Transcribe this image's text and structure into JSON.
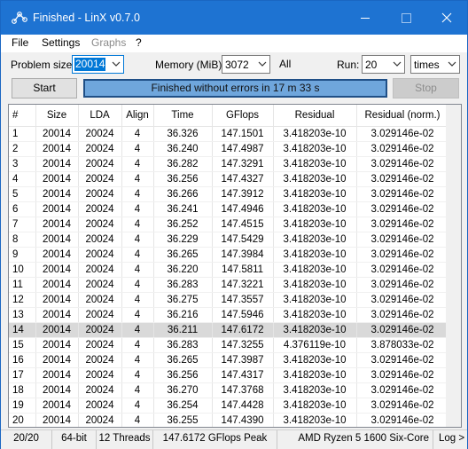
{
  "window": {
    "title": "Finished - LinX v0.7.0"
  },
  "menu": [
    "File",
    "Settings",
    "Graphs",
    "?"
  ],
  "controls": {
    "problem_size_label": "Problem size:",
    "problem_size_value": "20014",
    "memory_label": "Memory (MiB):",
    "memory_value": "3072",
    "all_label": "All",
    "run_label": "Run:",
    "run_value": "20",
    "run_unit": "times"
  },
  "actions": {
    "start_label": "Start",
    "status_text": "Finished without errors in 17 m 33 s",
    "stop_label": "Stop"
  },
  "table": {
    "columns": [
      "#",
      "Size",
      "LDA",
      "Align",
      "Time",
      "GFlops",
      "Residual",
      "Residual (norm.)"
    ],
    "selected_row": 14,
    "rows": [
      [
        "1",
        "20014",
        "20024",
        "4",
        "36.326",
        "147.1501",
        "3.418203e-10",
        "3.029146e-02"
      ],
      [
        "2",
        "20014",
        "20024",
        "4",
        "36.240",
        "147.4987",
        "3.418203e-10",
        "3.029146e-02"
      ],
      [
        "3",
        "20014",
        "20024",
        "4",
        "36.282",
        "147.3291",
        "3.418203e-10",
        "3.029146e-02"
      ],
      [
        "4",
        "20014",
        "20024",
        "4",
        "36.256",
        "147.4327",
        "3.418203e-10",
        "3.029146e-02"
      ],
      [
        "5",
        "20014",
        "20024",
        "4",
        "36.266",
        "147.3912",
        "3.418203e-10",
        "3.029146e-02"
      ],
      [
        "6",
        "20014",
        "20024",
        "4",
        "36.241",
        "147.4946",
        "3.418203e-10",
        "3.029146e-02"
      ],
      [
        "7",
        "20014",
        "20024",
        "4",
        "36.252",
        "147.4515",
        "3.418203e-10",
        "3.029146e-02"
      ],
      [
        "8",
        "20014",
        "20024",
        "4",
        "36.229",
        "147.5429",
        "3.418203e-10",
        "3.029146e-02"
      ],
      [
        "9",
        "20014",
        "20024",
        "4",
        "36.265",
        "147.3984",
        "3.418203e-10",
        "3.029146e-02"
      ],
      [
        "10",
        "20014",
        "20024",
        "4",
        "36.220",
        "147.5811",
        "3.418203e-10",
        "3.029146e-02"
      ],
      [
        "11",
        "20014",
        "20024",
        "4",
        "36.283",
        "147.3221",
        "3.418203e-10",
        "3.029146e-02"
      ],
      [
        "12",
        "20014",
        "20024",
        "4",
        "36.275",
        "147.3557",
        "3.418203e-10",
        "3.029146e-02"
      ],
      [
        "13",
        "20014",
        "20024",
        "4",
        "36.216",
        "147.5946",
        "3.418203e-10",
        "3.029146e-02"
      ],
      [
        "14",
        "20014",
        "20024",
        "4",
        "36.211",
        "147.6172",
        "3.418203e-10",
        "3.029146e-02"
      ],
      [
        "15",
        "20014",
        "20024",
        "4",
        "36.283",
        "147.3255",
        "4.376119e-10",
        "3.878033e-02"
      ],
      [
        "16",
        "20014",
        "20024",
        "4",
        "36.265",
        "147.3987",
        "3.418203e-10",
        "3.029146e-02"
      ],
      [
        "17",
        "20014",
        "20024",
        "4",
        "36.256",
        "147.4317",
        "3.418203e-10",
        "3.029146e-02"
      ],
      [
        "18",
        "20014",
        "20024",
        "4",
        "36.270",
        "147.3768",
        "3.418203e-10",
        "3.029146e-02"
      ],
      [
        "19",
        "20014",
        "20024",
        "4",
        "36.254",
        "147.4428",
        "3.418203e-10",
        "3.029146e-02"
      ],
      [
        "20",
        "20014",
        "20024",
        "4",
        "36.255",
        "147.4390",
        "3.418203e-10",
        "3.029146e-02"
      ]
    ]
  },
  "footer": {
    "progress": "20/20",
    "bits": "64-bit",
    "threads": "12 Threads",
    "peak": "147.6172 GFlops Peak",
    "cpu": "AMD Ryzen 5 1600 Six-Core",
    "log_label": "Log >"
  },
  "colors": {
    "titlebar": "#1e73d2",
    "status_fill": "#6fa6dc",
    "accent": "#0078d7"
  }
}
